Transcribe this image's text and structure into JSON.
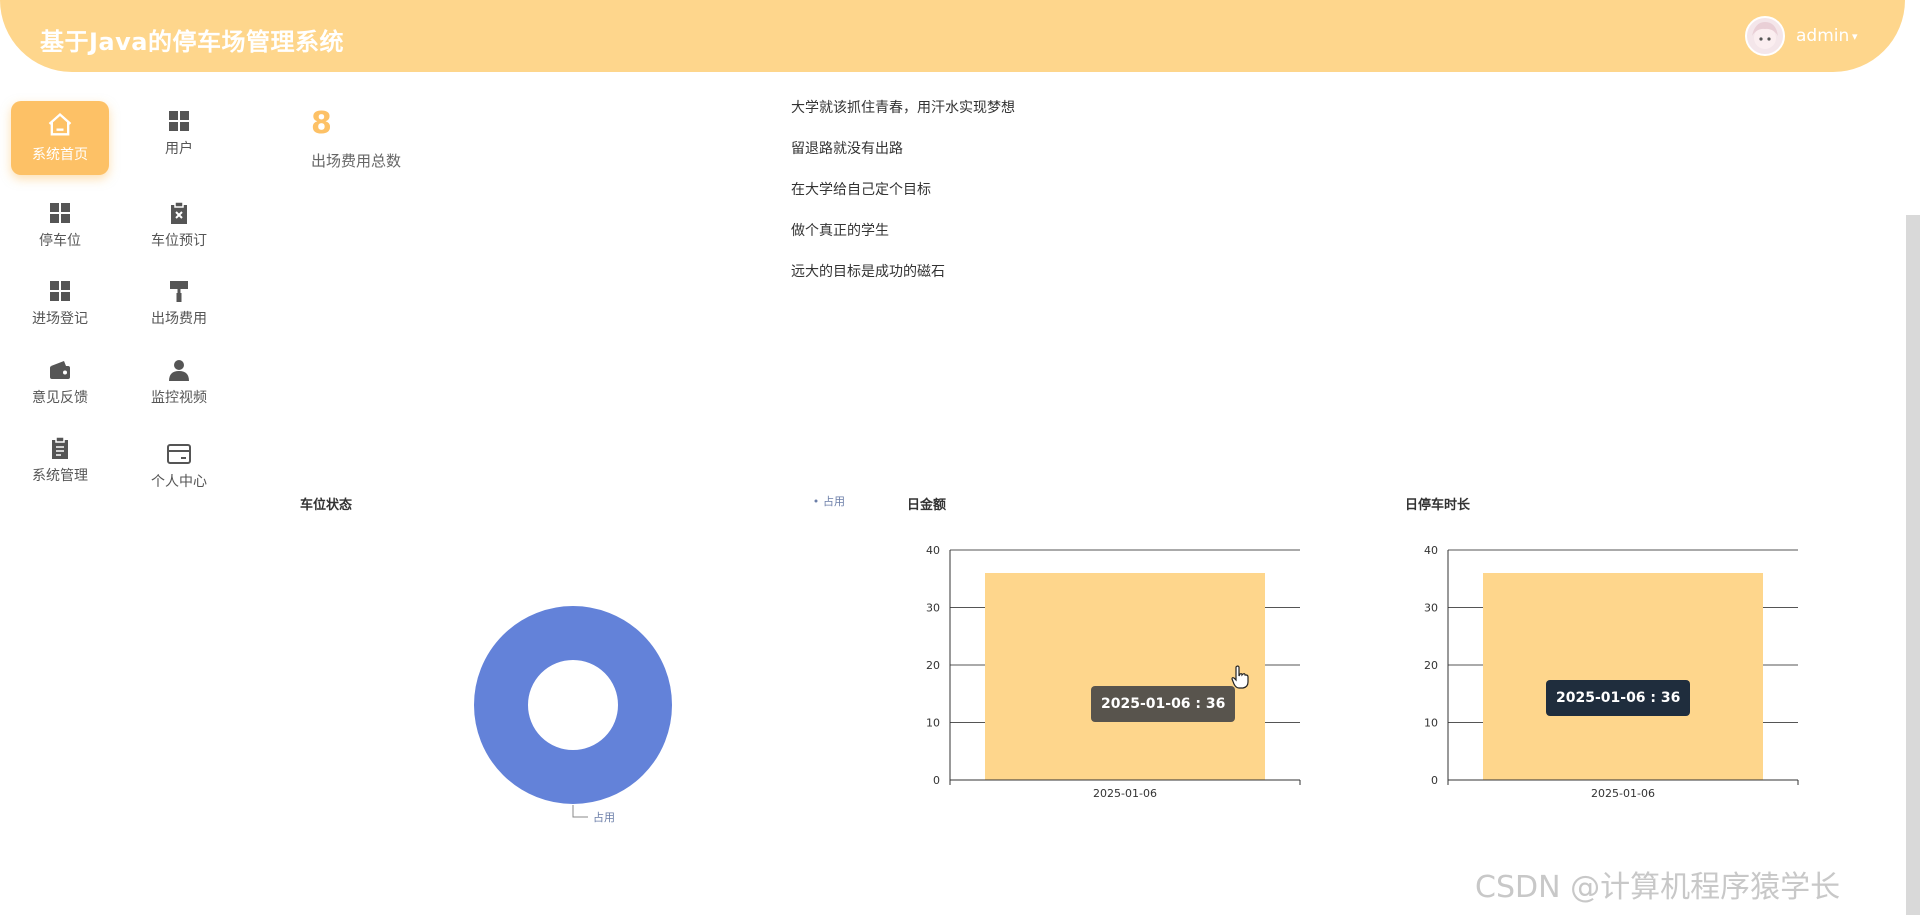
{
  "header": {
    "title": "基于Java的停车场管理系统",
    "user": "admin",
    "caret": "▾"
  },
  "sidebar": {
    "items": [
      {
        "label": "系统首页",
        "icon": "home-icon",
        "active": true
      },
      {
        "label": "用户",
        "icon": "grid-icon"
      },
      {
        "label": "停车位",
        "icon": "grid-icon"
      },
      {
        "label": "车位预订",
        "icon": "clipboard-x-icon"
      },
      {
        "label": "进场登记",
        "icon": "grid-icon"
      },
      {
        "label": "出场费用",
        "icon": "paint-roller-icon"
      },
      {
        "label": "意见反馈",
        "icon": "wallet-icon"
      },
      {
        "label": "监控视频",
        "icon": "user-icon"
      },
      {
        "label": "系统管理",
        "icon": "clipboard-icon"
      },
      {
        "label": "个人中心",
        "icon": "card-icon"
      }
    ]
  },
  "stat": {
    "value": "8",
    "label": "出场费用总数"
  },
  "mottos": [
    "大学就该抓住青春，用汗水实现梦想",
    "留退路就没有出路",
    "在大学给自己定个目标",
    "做个真正的学生",
    "远大的目标是成功的磁石"
  ],
  "colors": {
    "header": "#fed68c",
    "accent": "#fdc166",
    "bar": "#fed68c",
    "pie": "#6382d9"
  },
  "chart_data": [
    {
      "type": "pie",
      "title": "车位状态",
      "donut": true,
      "slices": [
        {
          "name": "占用",
          "value": 1
        }
      ],
      "legend": [
        "占用"
      ],
      "legend_position": "top-right"
    },
    {
      "type": "bar",
      "title": "日金额",
      "categories": [
        "2025-01-06"
      ],
      "values": [
        36
      ],
      "ylim": [
        0,
        40
      ],
      "yticks": [
        0,
        10,
        20,
        30,
        40
      ],
      "grid": true,
      "tooltip": "2025-01-06 : 36"
    },
    {
      "type": "bar",
      "title": "日停车时长",
      "categories": [
        "2025-01-06"
      ],
      "values": [
        36
      ],
      "ylim": [
        0,
        40
      ],
      "yticks": [
        0,
        10,
        20,
        30,
        40
      ],
      "grid": true,
      "tooltip": "2025-01-06 : 36"
    }
  ],
  "watermark": "CSDN @计算机程序猿学长"
}
